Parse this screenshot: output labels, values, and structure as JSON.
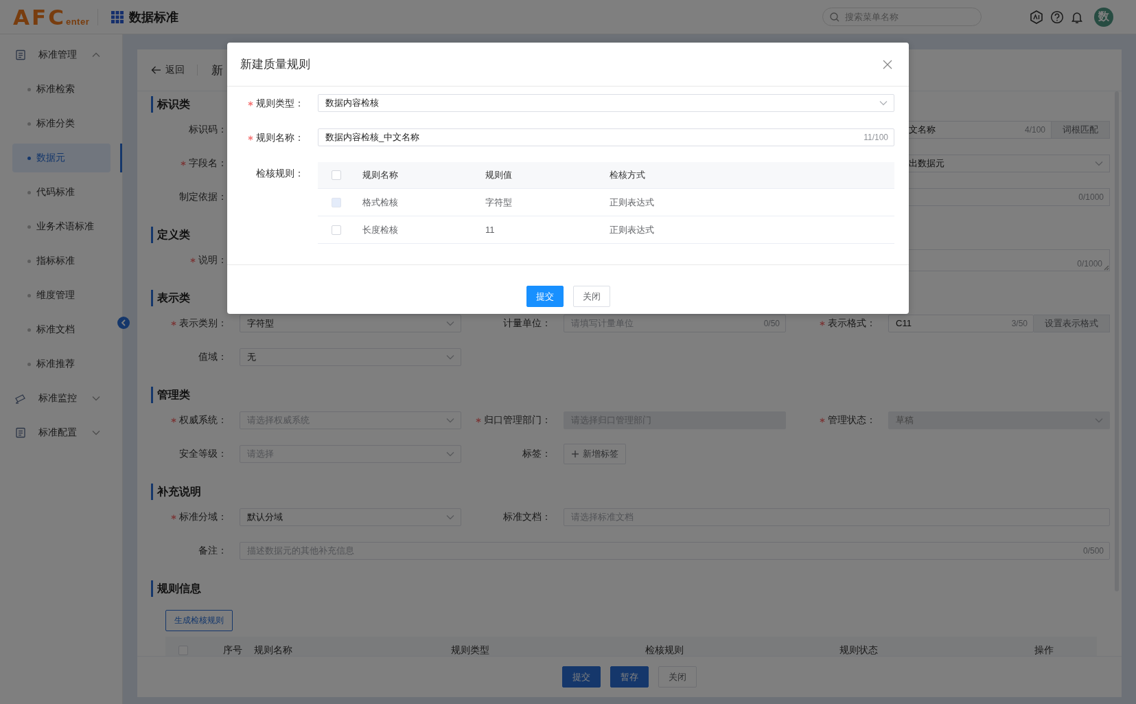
{
  "top_bar": {
    "logo_letters": "AFC",
    "logo_suffix": "enter",
    "app_title": "数据标准",
    "search": {
      "placeholder": "搜索菜单名称"
    },
    "avatar": "数"
  },
  "sidebar": {
    "items": [
      {
        "label": "标准管理",
        "expanded": true,
        "children": [
          {
            "label": "标准检索",
            "selected": false
          },
          {
            "label": "标准分类",
            "selected": false
          },
          {
            "label": "数据元",
            "selected": true
          },
          {
            "label": "代码标准",
            "selected": false
          },
          {
            "label": "业务术语标准",
            "selected": false
          },
          {
            "label": "指标标准",
            "selected": false
          },
          {
            "label": "维度管理",
            "selected": false
          },
          {
            "label": "标准文档",
            "selected": false
          },
          {
            "label": "标准推荐",
            "selected": false
          }
        ]
      },
      {
        "label": "标准监控",
        "expanded": false
      },
      {
        "label": "标准配置",
        "expanded": false
      }
    ]
  },
  "page": {
    "back": "返回",
    "title": "新",
    "sections": [
      {
        "title": "标识类",
        "rows": [
          [
            {
              "label": "标识码：",
              "required": false
            },
            {
              "field": {
                "kind": "fragment-input",
                "value": "文名称",
                "count": "4/100",
                "addon": "词根匹配"
              }
            }
          ],
          [
            {
              "label": "字段名：",
              "required": true
            },
            {
              "field": {
                "kind": "fragment-select",
                "value": "出数据元"
              }
            }
          ],
          [
            {
              "label": "制定依据：",
              "required": false
            },
            {
              "field": {
                "kind": "fragment-input",
                "count": "0/1000"
              }
            }
          ]
        ]
      },
      {
        "title": "定义类",
        "rows": [
          [
            {
              "label": "说明：",
              "required": true
            },
            {
              "field": {
                "kind": "fragment-textarea",
                "count": "0/1000"
              }
            }
          ]
        ]
      },
      {
        "title": "表示类",
        "rows": [
          [
            {
              "label": "表示类别：",
              "required": true,
              "field": {
                "kind": "select",
                "value": "字符型",
                "disabled": false
              }
            },
            {
              "label": "计量单位：",
              "required": false,
              "field": {
                "kind": "input",
                "placeholder": "请填写计量单位",
                "count": "0/50",
                "disabled": false
              }
            },
            {
              "label": "表示格式：",
              "required": true,
              "field": {
                "kind": "input",
                "value": "C11",
                "count": "3/50",
                "addon": "设置表示格式",
                "disabled": false
              }
            }
          ],
          [
            {
              "label": "值域：",
              "required": false,
              "field": {
                "kind": "select",
                "value": "无",
                "disabled": false
              }
            }
          ]
        ]
      },
      {
        "title": "管理类",
        "rows": [
          [
            {
              "label": "权威系统：",
              "required": true,
              "field": {
                "kind": "select",
                "placeholder": "请选择权威系统",
                "disabled": false
              }
            },
            {
              "label": "归口管理部门：",
              "required": true,
              "field": {
                "kind": "input",
                "placeholder": "请选择归口管理部门",
                "disabled": true
              }
            },
            {
              "label": "管理状态：",
              "required": true,
              "field": {
                "kind": "select",
                "value": "草稿",
                "disabled": true
              }
            }
          ],
          [
            {
              "label": "安全等级：",
              "required": false,
              "field": {
                "kind": "select",
                "placeholder": "请选择",
                "disabled": false
              }
            },
            {
              "label": "标签：",
              "required": false,
              "field": {
                "kind": "button",
                "text": "新增标签"
              }
            }
          ]
        ]
      },
      {
        "title": "补充说明",
        "rows": [
          [
            {
              "label": "标准分域：",
              "required": true,
              "field": {
                "kind": "select",
                "value": "默认分域",
                "disabled": false
              }
            },
            {
              "label": "标准文档：",
              "required": false,
              "field": {
                "kind": "wide-input",
                "placeholder": "请选择标准文档",
                "disabled": false
              }
            }
          ],
          [
            {
              "label": "备注：",
              "required": false,
              "field": {
                "kind": "wide-input",
                "placeholder": "描述数据元的其他补充信息",
                "count": "0/500",
                "disabled": false
              }
            }
          ]
        ]
      },
      {
        "title": "规则信息",
        "action_button": "生成检核规则",
        "table": {
          "header_checked": false,
          "columns": [
            "序号",
            "规则名称",
            "规则类型",
            "检核规则",
            "规则状态",
            "操作"
          ]
        }
      }
    ],
    "footer_buttons": [
      {
        "label": "提交",
        "kind": "primary"
      },
      {
        "label": "暂存",
        "kind": "primary"
      },
      {
        "label": "关闭",
        "kind": "default"
      }
    ]
  },
  "dialog": {
    "title": "新建质量规则",
    "fields": [
      {
        "label": "规则类型：",
        "required": true,
        "kind": "select",
        "value": "数据内容检核"
      },
      {
        "label": "规则名称：",
        "required": true,
        "kind": "input",
        "value": "数据内容检核_中文名称",
        "count": "11/100"
      }
    ],
    "rules": {
      "label": "检核规则：",
      "required": false,
      "header_checked": false,
      "columns": [
        "规则名称",
        "规则值",
        "检核方式"
      ],
      "rows": [
        {
          "checked": false,
          "disabled": true,
          "cells": [
            "格式检核",
            "字符型",
            "正则表达式"
          ]
        },
        {
          "checked": false,
          "disabled": false,
          "cells": [
            "长度检核",
            "11",
            "正则表达式"
          ]
        }
      ]
    },
    "buttons": [
      {
        "label": "提交",
        "kind": "primary"
      },
      {
        "label": "关闭",
        "kind": "default"
      }
    ]
  }
}
